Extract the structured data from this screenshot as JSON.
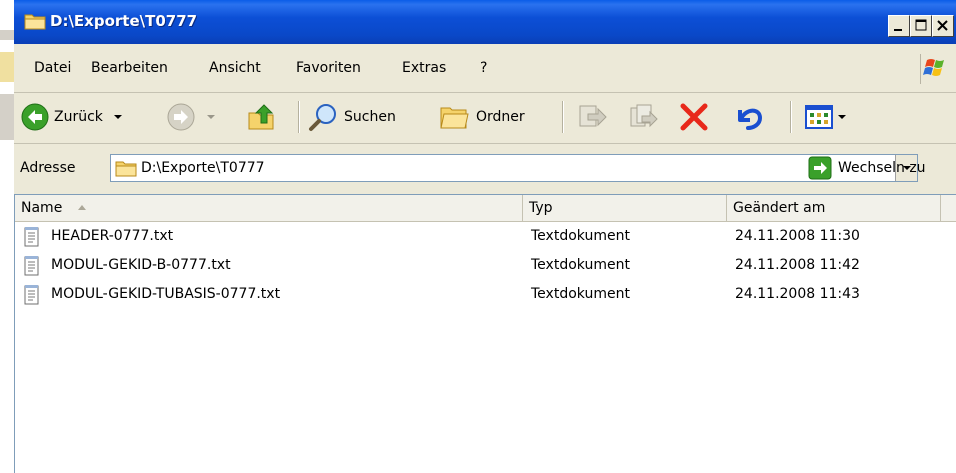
{
  "window": {
    "title": "D:\\Exporte\\T0777",
    "caption_buttons": [
      "_",
      "□",
      "×"
    ]
  },
  "menu": {
    "items": [
      "Datei",
      "Bearbeiten",
      "Ansicht",
      "Favoriten",
      "Extras",
      "?"
    ]
  },
  "toolbar": {
    "back_label": "Zurück",
    "search_label": "Suchen",
    "folders_label": "Ordner"
  },
  "address": {
    "label": "Adresse",
    "value": "D:\\Exporte\\T0777",
    "go_label": "Wechseln zu"
  },
  "list": {
    "columns": [
      "Name",
      "Typ",
      "Geändert am"
    ],
    "sort_column": "Name",
    "rows": [
      {
        "name": "HEADER-0777.txt",
        "type": "Textdokument",
        "modified": "24.11.2008 11:30"
      },
      {
        "name": "MODUL-GEKID-B-0777.txt",
        "type": "Textdokument",
        "modified": "24.11.2008 11:42"
      },
      {
        "name": "MODUL-GEKID-TUBASIS-0777.txt",
        "type": "Textdokument",
        "modified": "24.11.2008 11:43"
      }
    ]
  },
  "colors": {
    "titlebar": "#0a48c8",
    "window_bg": "#ece9d8",
    "delete_red": "#e8281a",
    "back_green": "#3aa02a"
  }
}
